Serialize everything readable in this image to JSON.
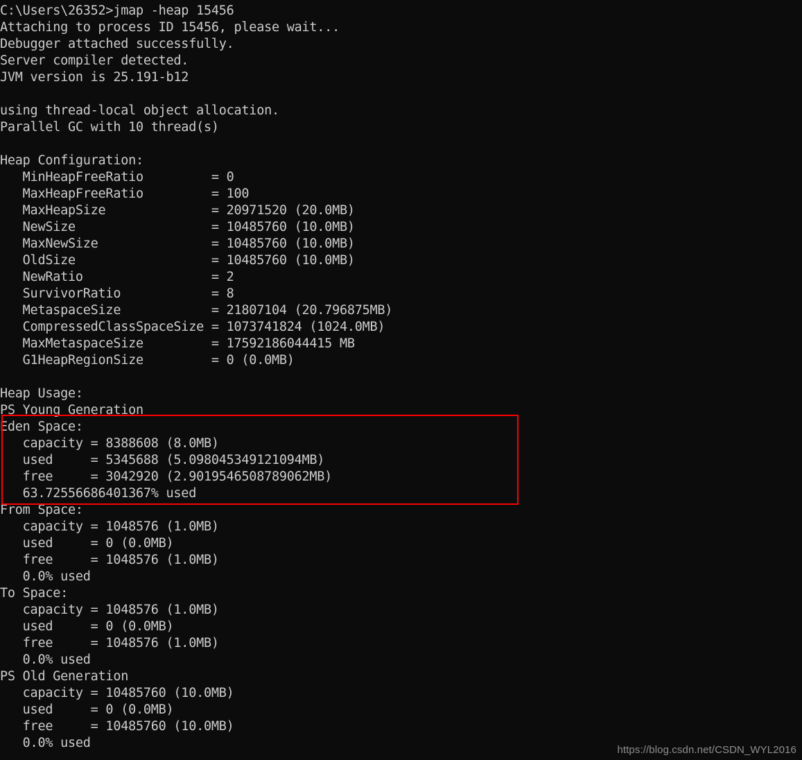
{
  "terminal": {
    "background_color": "#0c0c0c",
    "text_color": "#cccccc",
    "prompt_line": "C:\\Users\\26352>jmap -heap 15456",
    "lines": [
      "C:\\Users\\26352>jmap -heap 15456",
      "Attaching to process ID 15456, please wait...",
      "Debugger attached successfully.",
      "Server compiler detected.",
      "JVM version is 25.191-b12",
      "",
      "using thread-local object allocation.",
      "Parallel GC with 10 thread(s)",
      "",
      "Heap Configuration:",
      "   MinHeapFreeRatio         = 0",
      "   MaxHeapFreeRatio         = 100",
      "   MaxHeapSize              = 20971520 (20.0MB)",
      "   NewSize                  = 10485760 (10.0MB)",
      "   MaxNewSize               = 10485760 (10.0MB)",
      "   OldSize                  = 10485760 (10.0MB)",
      "   NewRatio                 = 2",
      "   SurvivorRatio            = 8",
      "   MetaspaceSize            = 21807104 (20.796875MB)",
      "   CompressedClassSpaceSize = 1073741824 (1024.0MB)",
      "   MaxMetaspaceSize         = 17592186044415 MB",
      "   G1HeapRegionSize         = 0 (0.0MB)",
      "",
      "Heap Usage:",
      "PS Young Generation",
      "Eden Space:",
      "   capacity = 8388608 (8.0MB)",
      "   used     = 5345688 (5.098045349121094MB)",
      "   free     = 3042920 (2.9019546508789062MB)",
      "   63.72556686401367% used",
      "From Space:",
      "   capacity = 1048576 (1.0MB)",
      "   used     = 0 (0.0MB)",
      "   free     = 1048576 (1.0MB)",
      "   0.0% used",
      "To Space:",
      "   capacity = 1048576 (1.0MB)",
      "   used     = 0 (0.0MB)",
      "   free     = 1048576 (1.0MB)",
      "   0.0% used",
      "PS Old Generation",
      "   capacity = 10485760 (10.0MB)",
      "   used     = 0 (0.0MB)",
      "   free     = 10485760 (10.0MB)",
      "   0.0% used"
    ]
  },
  "command": {
    "prompt": "C:\\Users\\26352>",
    "text": "jmap -heap 15456",
    "tool": "jmap",
    "flag": "-heap",
    "pid": "15456"
  },
  "attach_messages": {
    "attaching": "Attaching to process ID 15456, please wait...",
    "debugger": "Debugger attached successfully.",
    "compiler": "Server compiler detected.",
    "jvm_version": "JVM version is 25.191-b12"
  },
  "gc_info": {
    "allocation": "using thread-local object allocation.",
    "collector": "Parallel GC with 10 thread(s)"
  },
  "heap_configuration": {
    "title": "Heap Configuration:",
    "entries": [
      {
        "name": "MinHeapFreeRatio",
        "eq": "=",
        "value": "0"
      },
      {
        "name": "MaxHeapFreeRatio",
        "eq": "=",
        "value": "100"
      },
      {
        "name": "MaxHeapSize",
        "eq": "=",
        "value": "20971520 (20.0MB)"
      },
      {
        "name": "NewSize",
        "eq": "=",
        "value": "10485760 (10.0MB)"
      },
      {
        "name": "MaxNewSize",
        "eq": "=",
        "value": "10485760 (10.0MB)"
      },
      {
        "name": "OldSize",
        "eq": "=",
        "value": "10485760 (10.0MB)"
      },
      {
        "name": "NewRatio",
        "eq": "=",
        "value": "2"
      },
      {
        "name": "SurvivorRatio",
        "eq": "=",
        "value": "8"
      },
      {
        "name": "MetaspaceSize",
        "eq": "=",
        "value": "21807104 (20.796875MB)"
      },
      {
        "name": "CompressedClassSpaceSize",
        "eq": "=",
        "value": "1073741824 (1024.0MB)"
      },
      {
        "name": "MaxMetaspaceSize",
        "eq": "=",
        "value": "17592186044415 MB"
      },
      {
        "name": "G1HeapRegionSize",
        "eq": "=",
        "value": "0 (0.0MB)"
      }
    ]
  },
  "heap_usage": {
    "title": "Heap Usage:",
    "young_generation_label": "PS Young Generation",
    "old_generation_label": "PS Old Generation",
    "eden_space": {
      "label": "Eden Space:",
      "capacity": "   capacity = 8388608 (8.0MB)",
      "used": "   used     = 5345688 (5.098045349121094MB)",
      "free": "   free     = 3042920 (2.9019546508789062MB)",
      "percent": "   63.72556686401367% used"
    },
    "from_space": {
      "label": "From Space:",
      "capacity": "   capacity = 1048576 (1.0MB)",
      "used": "   used     = 0 (0.0MB)",
      "free": "   free     = 1048576 (1.0MB)",
      "percent": "   0.0% used"
    },
    "to_space": {
      "label": "To Space:",
      "capacity": "   capacity = 1048576 (1.0MB)",
      "used": "   used     = 0 (0.0MB)",
      "free": "   free     = 1048576 (1.0MB)",
      "percent": "   0.0% used"
    },
    "old_generation": {
      "capacity": "   capacity = 10485760 (10.0MB)",
      "used": "   used     = 0 (0.0MB)",
      "free": "   free     = 10485760 (10.0MB)",
      "percent": "   0.0% used"
    }
  },
  "annotation": {
    "highlight_color": "#ff0000",
    "highlight_target": "Eden Space block"
  },
  "watermark": {
    "text": "https://blog.csdn.net/CSDN_WYL2016",
    "color": "#8f8f8f"
  }
}
